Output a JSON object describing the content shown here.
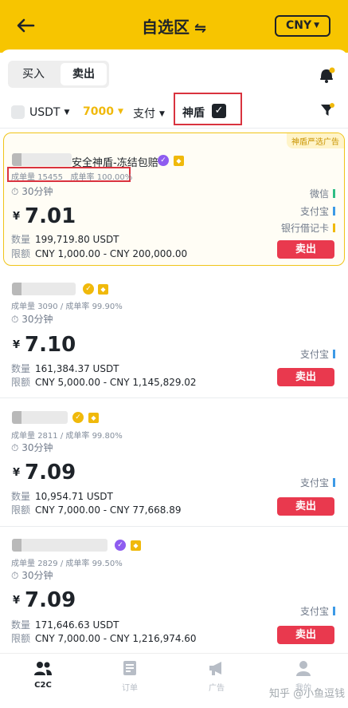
{
  "header": {
    "title": "自选区",
    "currency": "CNY"
  },
  "segments": {
    "buy": "买入",
    "sell": "卖出"
  },
  "filters": {
    "coin": "USDT",
    "amount": "7000",
    "payment": "支付",
    "shield": "神盾"
  },
  "featured_tag": "神盾严选广告",
  "ads": [
    {
      "merchant_suffix": "安全神盾-冻结包赔",
      "orders_label": "成单量",
      "orders": "15455",
      "rate_label": "成单率",
      "rate": "100.00%",
      "time": "30分钟",
      "price": "7.01",
      "qty_label": "数量",
      "qty": "199,719.80 USDT",
      "limit_label": "限额",
      "limit": "CNY 1,000.00 - CNY 200,000.00",
      "payments": [
        "微信",
        "支付宝",
        "银行借记卡"
      ],
      "action": "卖出"
    },
    {
      "orders_label": "成单量",
      "orders": "3090",
      "rate_label": "成单率",
      "rate": "99.90%",
      "time": "30分钟",
      "price": "7.10",
      "qty_label": "数量",
      "qty": "161,384.37 USDT",
      "limit_label": "限额",
      "limit": "CNY 5,000.00 - CNY 1,145,829.02",
      "payments": [
        "支付宝"
      ],
      "action": "卖出"
    },
    {
      "orders_label": "成单量",
      "orders": "2811",
      "rate_label": "成单率",
      "rate": "99.80%",
      "time": "30分钟",
      "price": "7.09",
      "qty_label": "数量",
      "qty": "10,954.71 USDT",
      "limit_label": "限额",
      "limit": "CNY 7,000.00 - CNY 77,668.89",
      "payments": [
        "支付宝"
      ],
      "action": "卖出"
    },
    {
      "orders_label": "成单量",
      "orders": "2829",
      "rate_label": "成单率",
      "rate": "99.50%",
      "time": "30分钟",
      "price": "7.09",
      "qty_label": "数量",
      "qty": "171,646.63 USDT",
      "limit_label": "限额",
      "limit": "CNY 7,000.00 - CNY 1,216,974.60",
      "payments": [
        "支付宝"
      ],
      "action": "卖出"
    }
  ],
  "currency_symbol": "¥",
  "tabs": {
    "c2c": "C2C",
    "orders": "订单",
    "ads": "广告",
    "mine": "我的"
  },
  "watermark": "知乎 @小鱼逗钱",
  "colors": {
    "brand": "#f7c500",
    "sell": "#e9394e",
    "wechat": "#2ebd85",
    "alipay": "#3d9ae6",
    "bank": "#f0b90b"
  }
}
